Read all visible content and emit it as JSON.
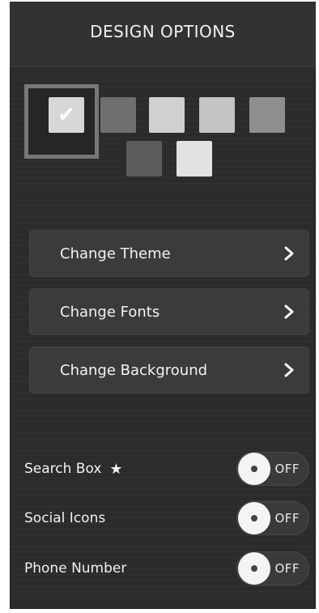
{
  "header": {
    "title": "DESIGN OPTIONS"
  },
  "swatches": {
    "selected_index": 0,
    "colors": [
      "#d7d7d7",
      "#6f6f6f",
      "#d0d0d0",
      "#c4c4c4",
      "#8e8e8e",
      "#5c5c5c",
      "#e2e2e2"
    ],
    "check_glyph": "✔"
  },
  "menu": {
    "items": [
      {
        "label": "Change Theme"
      },
      {
        "label": "Change Fonts"
      },
      {
        "label": "Change Background"
      }
    ]
  },
  "toggles": {
    "items": [
      {
        "label": "Search Box",
        "icon": "star-icon",
        "state": "OFF"
      },
      {
        "label": "Social Icons",
        "state": "OFF"
      },
      {
        "label": "Phone Number",
        "state": "OFF"
      }
    ]
  },
  "icons": {
    "chevron": "chevron-right-icon",
    "star": "★"
  }
}
